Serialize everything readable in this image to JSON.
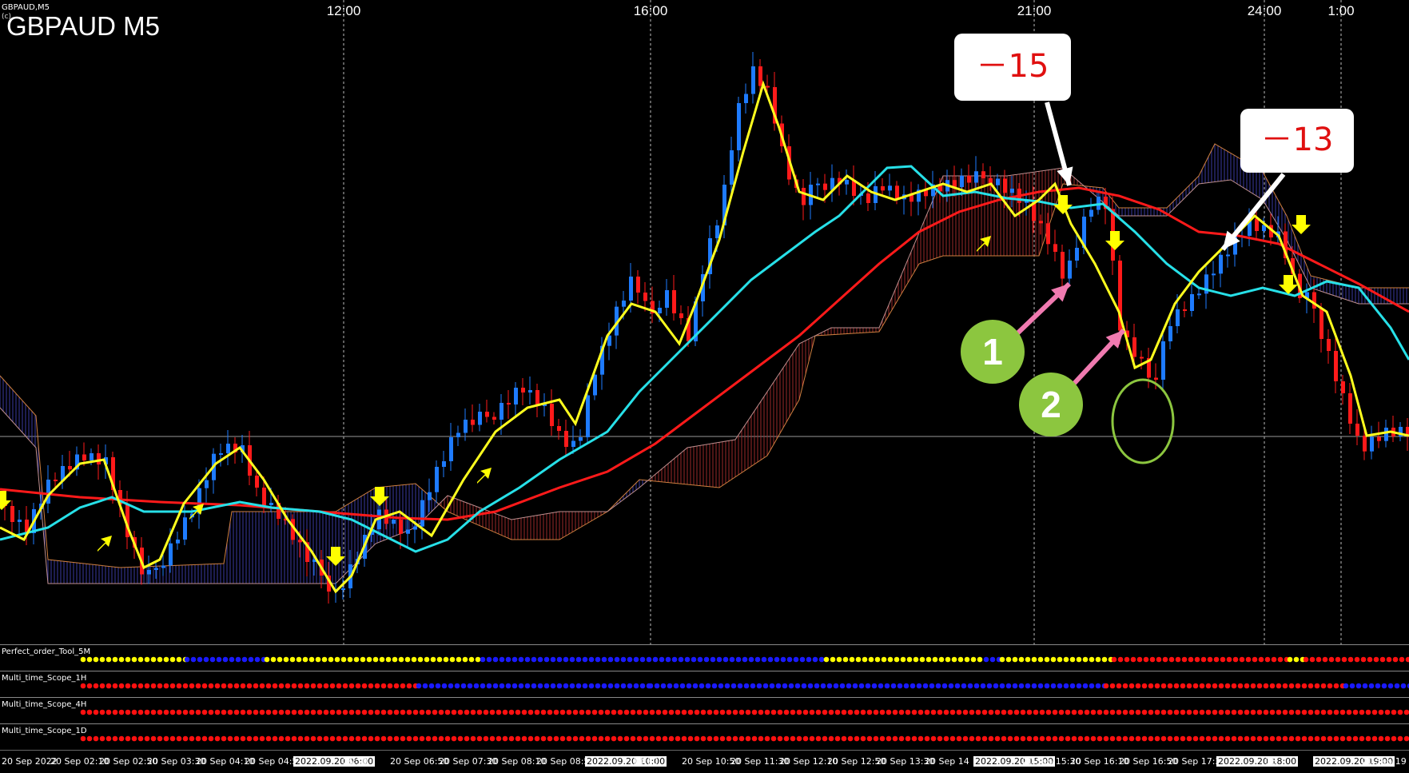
{
  "window": {
    "title": "GBPAUD,M5",
    "subtitle": "(c) …",
    "symbol_label": "GBPAUD M5"
  },
  "top_time_labels": [
    "12:00",
    "16:00",
    "21:00",
    "24:00",
    "1:00"
  ],
  "annotations": {
    "callout_1": "－15",
    "callout_2": "－13",
    "marker_1": "1",
    "marker_2": "2"
  },
  "indicator_panels": [
    {
      "label": "Perfect_order_Tool_5M"
    },
    {
      "label": "Multi_time_Scope_1H"
    },
    {
      "label": "Multi_time_Scope_4H"
    },
    {
      "label": "Multi_time_Scope_1D"
    }
  ],
  "x_axis_labels": [
    {
      "text": "20 Sep 2022",
      "highlight": false
    },
    {
      "text": "20 Sep 02:10",
      "highlight": false
    },
    {
      "text": "20 Sep 02:50",
      "highlight": false
    },
    {
      "text": "20 Sep 03:30",
      "highlight": false
    },
    {
      "text": "20 Sep 04:10",
      "highlight": false
    },
    {
      "text": "20 Sep 04:50",
      "highlight": false
    },
    {
      "text": "2022.09.20 06:00",
      "highlight": true
    },
    {
      "text": "06:10",
      "highlight": false
    },
    {
      "text": "20 Sep 06:50",
      "highlight": false
    },
    {
      "text": "20 Sep 07:30",
      "highlight": false
    },
    {
      "text": "20 Sep 08:10",
      "highlight": false
    },
    {
      "text": "20 Sep 08:50",
      "highlight": false
    },
    {
      "text": "2022.09.20 10:00",
      "highlight": true
    },
    {
      "text": "10:10",
      "highlight": false
    },
    {
      "text": "20 Sep 10:50",
      "highlight": false
    },
    {
      "text": "20 Sep 11:30",
      "highlight": false
    },
    {
      "text": "20 Sep 12:10",
      "highlight": false
    },
    {
      "text": "20 Sep 12:50",
      "highlight": false
    },
    {
      "text": "20 Sep 13:30",
      "highlight": false
    },
    {
      "text": "20 Sep 14",
      "highlight": false
    },
    {
      "text": "2022.09.20 15:00",
      "highlight": true
    },
    {
      "text": "20 Sep 15:30",
      "highlight": false
    },
    {
      "text": "20 Sep 16:10",
      "highlight": false
    },
    {
      "text": "20 Sep 16:50",
      "highlight": false
    },
    {
      "text": "20 Sep 17:30",
      "highlight": false
    },
    {
      "text": "2022.09.20 18:00",
      "highlight": true
    },
    {
      "text": "18",
      "highlight": false
    },
    {
      "text": "2022.09.20 19:00",
      "highlight": true
    },
    {
      "text": "20 Sep 19",
      "highlight": false
    }
  ],
  "colors": {
    "background": "#000000",
    "bull_candle": "#1e7bff",
    "bear_candle": "#ff1a1a",
    "ma_fast": "#ffff1e",
    "ma_mid": "#27e0e8",
    "ma_slow": "#ff1a1a",
    "cloud_bull": "#3a3aa0",
    "cloud_bear": "#9a2a2a",
    "signal": "#ffff00",
    "callout_text": "#e01010",
    "marker_fill": "#8cc63f",
    "arrow_pink": "#f07ab0",
    "arrow_white": "#ffffff",
    "dot_yellow": "#ffff00",
    "dot_blue": "#1a1aff",
    "dot_red": "#ff1010"
  }
}
